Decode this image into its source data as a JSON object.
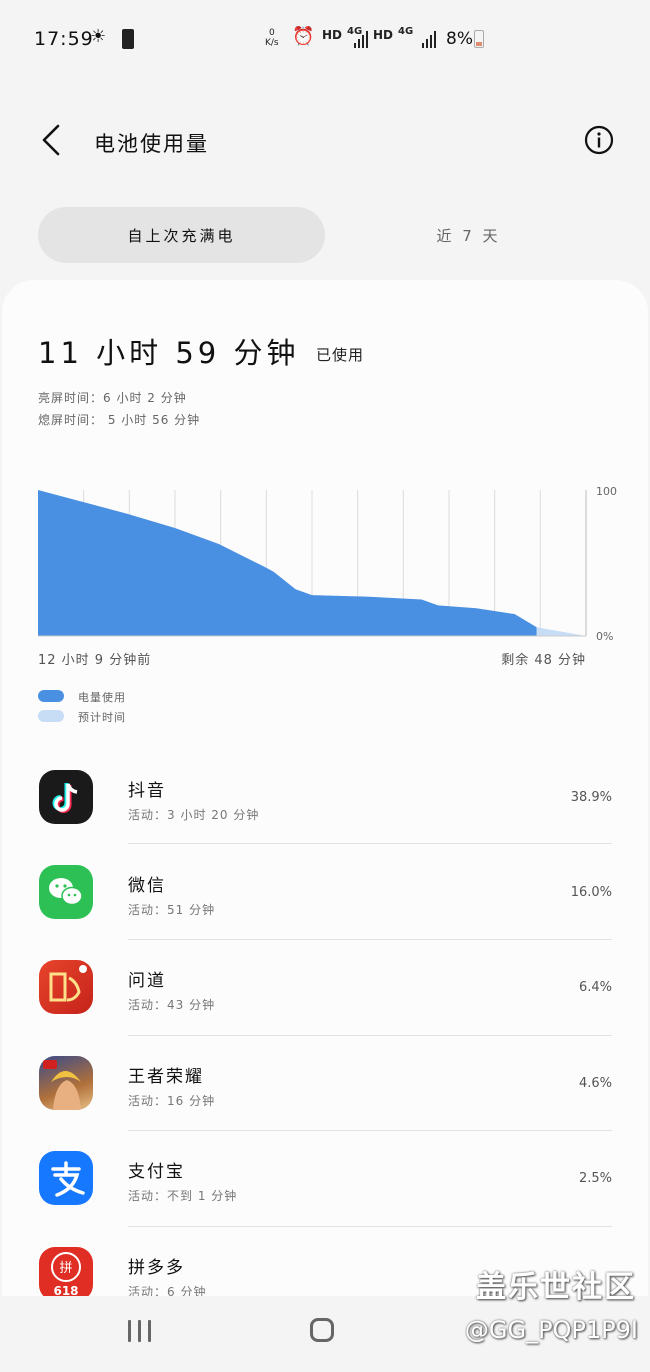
{
  "status_bar": {
    "time": "17:59",
    "speed_value": "0",
    "speed_unit": "K/s",
    "network1": "HD",
    "network1_type": "4G",
    "network2": "HD",
    "network2_type": "4G",
    "battery_percent": "8%",
    "icons": [
      "brightness-icon",
      "battery-saver-icon",
      "alarm-icon",
      "signal-icon",
      "battery-icon"
    ]
  },
  "header": {
    "title": "电池使用量"
  },
  "tabs": [
    {
      "label": "自上次充满电",
      "active": true
    },
    {
      "label": "近 7 天",
      "active": false
    }
  ],
  "summary": {
    "hours": "11",
    "hours_unit": "小时",
    "minutes": "59",
    "minutes_unit": "分钟",
    "suffix": "已使用",
    "screen_on": "亮屏时间：6 小时 2 分钟",
    "screen_off": "熄屏时间： 5 小时 56 分钟"
  },
  "chart_data": {
    "type": "area",
    "y_max_label": "100",
    "y_min_label": "0%",
    "x_start_label": "12 小时 9 分钟前",
    "x_end_label": "剩余 48 分钟",
    "ylim": [
      0,
      100
    ],
    "series": [
      {
        "name": "电量使用",
        "color": "#4a90e2",
        "x": [
          0,
          0.09,
          0.16,
          0.25,
          0.33,
          0.41,
          0.43,
          0.47,
          0.5,
          0.6,
          0.7,
          0.73,
          0.8,
          0.87,
          0.91
        ],
        "values": [
          100,
          91,
          84,
          74,
          63,
          48,
          44,
          32,
          28,
          27,
          25,
          21,
          19,
          15,
          6
        ]
      },
      {
        "name": "预计时间",
        "color": "#c6ddf5",
        "x": [
          0.91,
          1.0
        ],
        "values": [
          6,
          0
        ]
      }
    ],
    "gridlines": 12
  },
  "legend": [
    {
      "label": "电量使用",
      "color": "#4a90e2"
    },
    {
      "label": "预计时间",
      "color": "#c6ddf5"
    }
  ],
  "apps": [
    {
      "name": "抖音",
      "activity": "活动：3 小时 20 分钟",
      "percent": "38.9%",
      "icon": "douyin-icon"
    },
    {
      "name": "微信",
      "activity": "活动：51 分钟",
      "percent": "16.0%",
      "icon": "wechat-icon"
    },
    {
      "name": "问道",
      "activity": "活动：43 分钟",
      "percent": "6.4%",
      "icon": "wendao-icon"
    },
    {
      "name": "王者荣耀",
      "activity": "活动：16 分钟",
      "percent": "4.6%",
      "icon": "honor-of-kings-icon"
    },
    {
      "name": "支付宝",
      "activity": "活动：不到 1 分钟",
      "percent": "2.5%",
      "icon": "alipay-icon"
    },
    {
      "name": "拼多多",
      "activity": "活动：6 分钟",
      "percent": "",
      "icon": "pinduoduo-icon",
      "icon_text_top": "拼",
      "icon_text_bottom": "618"
    }
  ],
  "watermark": {
    "line1": "盖乐世社区",
    "line2": "@GG_PQP1P9I"
  }
}
